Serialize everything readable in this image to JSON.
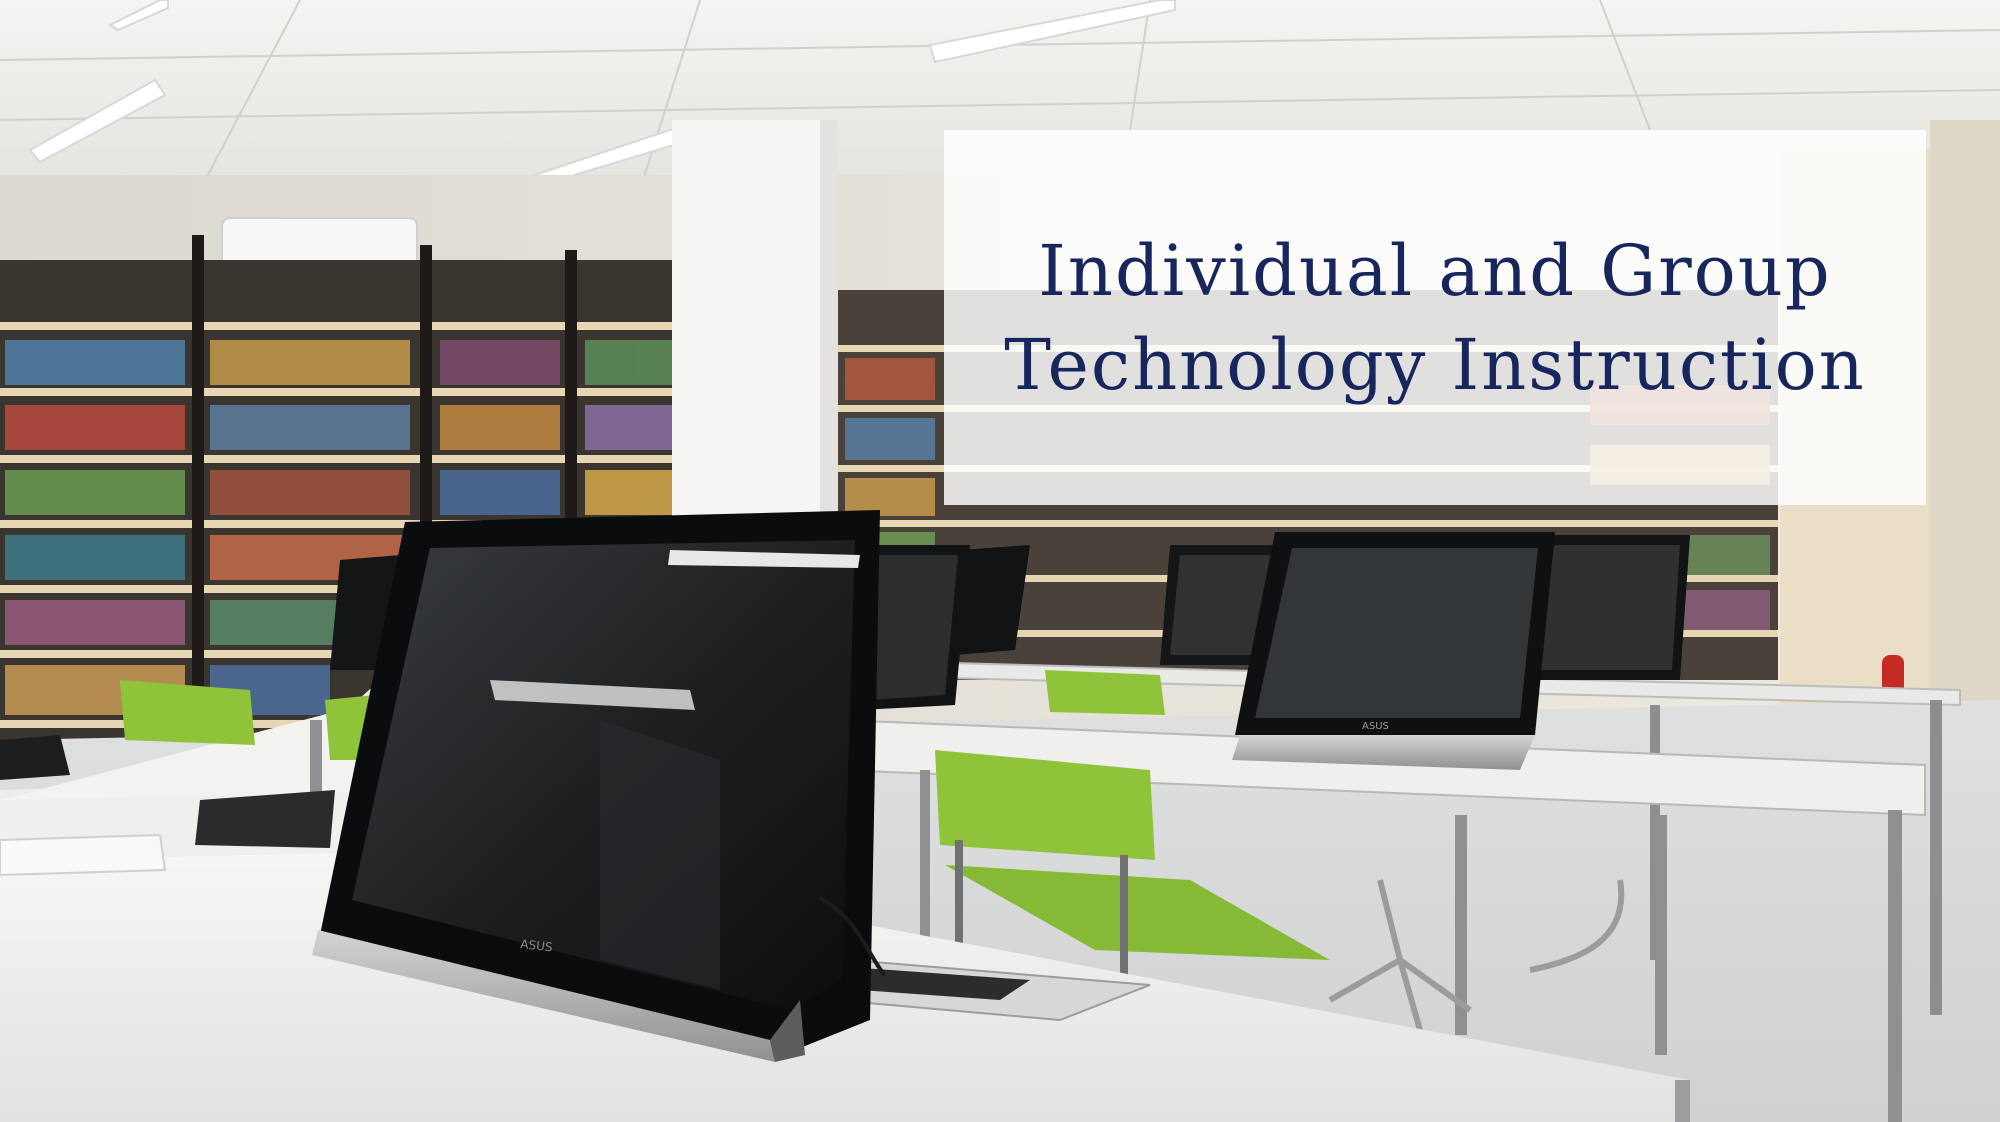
{
  "hero": {
    "title_line_1": "Individual and Group",
    "title_line_2": "Technology Instruction"
  },
  "colors": {
    "title_text": "#17275e",
    "chair_green": "#8fc43a",
    "desk_white": "#f1f1f0"
  },
  "photo": {
    "subject": "library computer lab with all-in-one monitors on white desks, green chairs and bookshelves"
  }
}
